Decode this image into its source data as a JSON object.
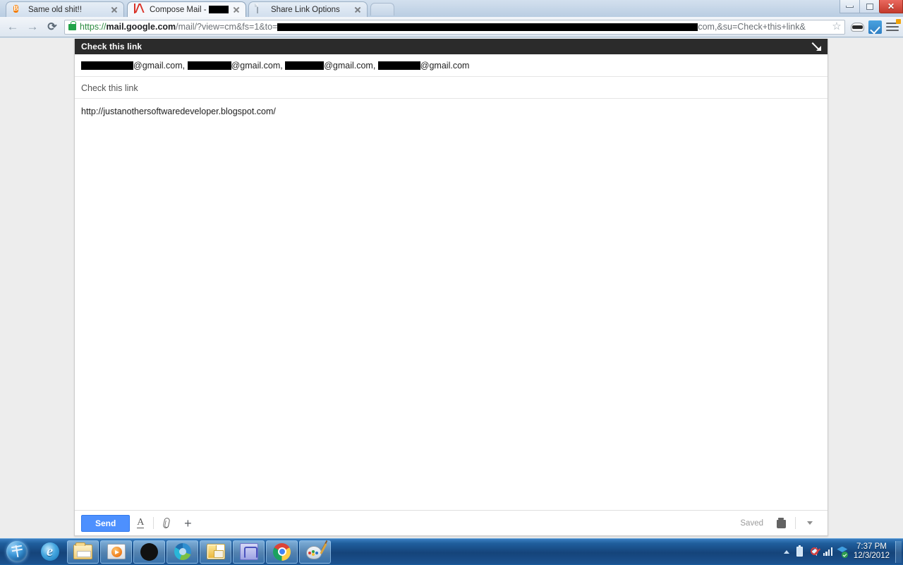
{
  "browser": {
    "tabs": [
      {
        "title": "Same old shit!!",
        "favicon": "blogger-icon",
        "active": false,
        "redacted": false
      },
      {
        "title": "Compose Mail - ",
        "favicon": "gmail-icon",
        "active": true,
        "redacted": true,
        "redact_width": 58
      },
      {
        "title": "Share Link Options",
        "favicon": "page-icon",
        "active": false,
        "redacted": false
      }
    ],
    "window_controls": {
      "minimize": "minimize-button",
      "restore": "restore-button",
      "close": "close-button"
    },
    "nav": {
      "back": "←",
      "forward": "→",
      "reload": "⟳"
    },
    "omnibox": {
      "security_icon": "lock-icon",
      "scheme": "https://",
      "host": "mail.google.com",
      "path_prefix": "/mail/?view=cm&fs=1&to=",
      "path_suffix": "com,&su=Check+this+link&",
      "redact_widths": [
        596
      ],
      "bookmark_icon": "☆"
    },
    "extensions": [
      "mask-extension-icon",
      "blue-check-extension-icon"
    ],
    "menu": {
      "name": "chrome-menu-button",
      "badge": true
    }
  },
  "compose": {
    "header_title": "Check this link",
    "header_action_icon": "minimize-arrow-icon",
    "to": {
      "recipients": [
        {
          "redact_width": 74,
          "domain": "@gmail.com"
        },
        {
          "redact_width": 62,
          "domain": "@gmail.com"
        },
        {
          "redact_width": 55,
          "domain": "@gmail.com"
        },
        {
          "redact_width": 60,
          "domain": "@gmail.com"
        }
      ],
      "separator": ", "
    },
    "subject": "Check this link",
    "body": "http://justanothersoftwaredeveloper.blogspot.com/",
    "footer": {
      "send_label": "Send",
      "format_icon": "format-text-icon",
      "attach_icon": "paperclip-icon",
      "insert_icon": "plus-icon",
      "saved_label": "Saved",
      "discard_icon": "trash-icon",
      "more_icon": "chevron-down-icon"
    },
    "accent_color": "#4d90fe"
  },
  "taskbar": {
    "start": "start-orb",
    "items": [
      "internet-explorer-icon",
      "file-explorer-icon",
      "windows-media-player-icon",
      "spotify-icon",
      "donut-app-icon",
      "contacts-mail-icon",
      "blue-app-icon",
      "google-chrome-icon",
      "paint-icon"
    ],
    "tray": {
      "expand_icon": "show-hidden-icons-arrow",
      "icons": [
        "battery-icon",
        "volume-muted-icon",
        "signal-bars-icon",
        "dropbox-icon"
      ],
      "time": "7:37 PM",
      "date": "12/3/2012"
    }
  }
}
